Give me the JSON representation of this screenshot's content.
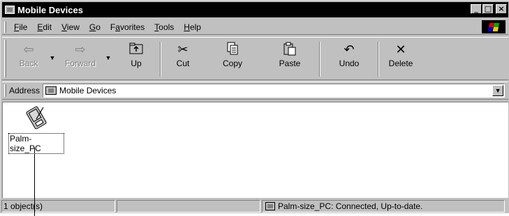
{
  "window": {
    "title": "Mobile Devices",
    "controls": {
      "minimize": "_",
      "maximize": "□",
      "close": "×"
    }
  },
  "menu": {
    "items": [
      {
        "label": "File",
        "accel": "F"
      },
      {
        "label": "Edit",
        "accel": "E"
      },
      {
        "label": "View",
        "accel": "V"
      },
      {
        "label": "Go",
        "accel": "G"
      },
      {
        "label": "Favorites",
        "accel": "a"
      },
      {
        "label": "Tools",
        "accel": "T"
      },
      {
        "label": "Help",
        "accel": "H"
      }
    ]
  },
  "toolbar": {
    "back": {
      "label": "Back",
      "icon": "back-arrow-icon",
      "disabled": true
    },
    "forward": {
      "label": "Forward",
      "icon": "forward-arrow-icon",
      "disabled": true
    },
    "up": {
      "label": "Up",
      "icon": "up-folder-icon"
    },
    "cut": {
      "label": "Cut",
      "icon": "scissors-icon"
    },
    "copy": {
      "label": "Copy",
      "icon": "copy-icon"
    },
    "paste": {
      "label": "Paste",
      "icon": "paste-icon"
    },
    "undo": {
      "label": "Undo",
      "icon": "undo-icon"
    },
    "delete": {
      "label": "Delete",
      "icon": "delete-x-icon"
    }
  },
  "address": {
    "label": "Address",
    "value": "Mobile Devices"
  },
  "content": {
    "items": [
      {
        "label": "Palm-size_PC",
        "icon": "palm-device-icon"
      }
    ]
  },
  "status": {
    "count": "1 object(s)",
    "middle": "",
    "connection": "Palm-size_PC: Connected, Up-to-date."
  }
}
